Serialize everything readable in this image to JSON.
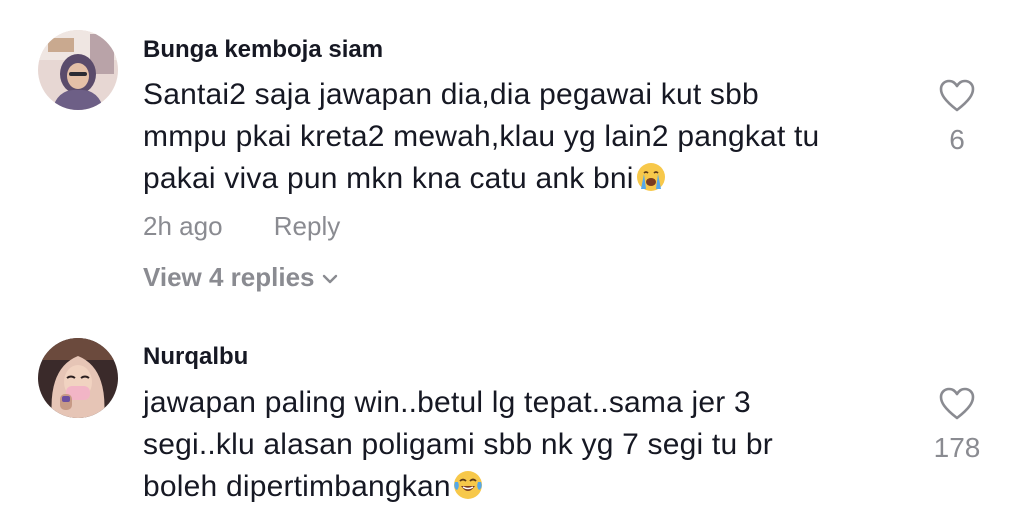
{
  "comments": [
    {
      "username": "Bunga kemboja siam",
      "lines": [
        "Santai2 saja jawapan dia,dia pegawai kut sbb",
        "mmpu pkai kreta2 mewah,klau yg lain2 pangkat tu",
        "pakai viva pun mkn kna catu ank bni"
      ],
      "emoji": "loudly-crying-face",
      "time": "2h ago",
      "reply_label": "Reply",
      "view_replies": "View 4 replies",
      "likes": "6"
    },
    {
      "username": "Nurqalbu",
      "lines": [
        "jawapan paling win..betul lg tepat..sama jer 3",
        "segi..klu alasan poligami sbb nk yg 7 segi tu br",
        "boleh dipertimbangkan"
      ],
      "emoji": "tears-of-joy-face",
      "likes": "178"
    }
  ]
}
